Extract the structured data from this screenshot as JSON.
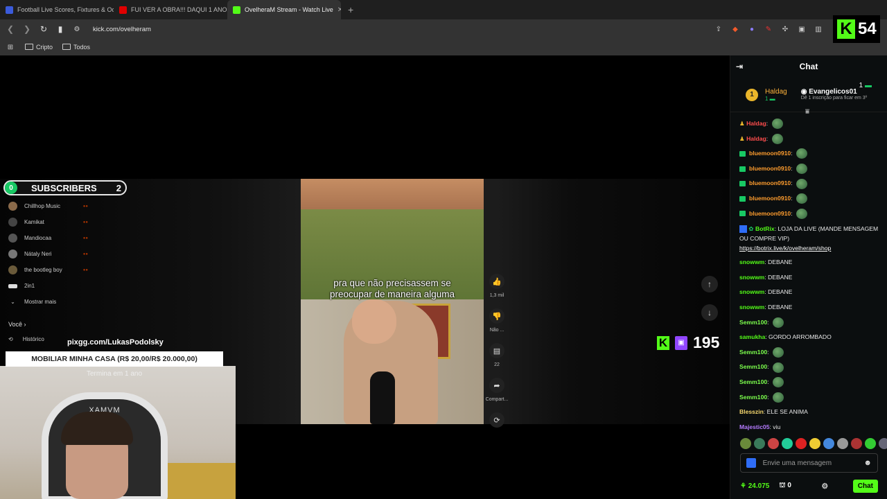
{
  "browser": {
    "tabs": [
      {
        "title": "Football Live Scores, Fixtures & Odds",
        "favicon_color": "#3b5bdb",
        "active": false
      },
      {
        "title": "FUI VER A OBRA!!! DAQUI 1 ANO VOU",
        "favicon_color": "#e00000",
        "active": false
      },
      {
        "title": "OvelheraM Stream - Watch Live",
        "favicon_color": "#53fc18",
        "active": true
      }
    ],
    "new_tab_glyph": "+",
    "close_glyph": "✕",
    "url": "kick.com/ovelheram",
    "bookmarks": [
      "Cripto",
      "Todos"
    ],
    "badge_count": "54"
  },
  "stream": {
    "subscribers_label": "SUBSCRIBERS",
    "subscribers_left": "0",
    "subscribers_right": "2",
    "youtube_sidebar": [
      "Chillhop Music",
      "Kamikat",
      "Mandiocaa",
      "Nátaly Neri",
      "the bootleg boy",
      "2in1",
      "Mostrar mais"
    ],
    "voce": "Você",
    "historico": "Histórico",
    "pix_link": "pixgg.com/LukasPodolsky",
    "goal_text": "MOBILIAR MINHA CASA (R$ 20,00/R$ 20.000,00)",
    "goal_sub": "Termina em 1 ano",
    "chair_brand": "XAMVM",
    "caption_line1": "pra que não precisassem se",
    "caption_line2": "preocupar de maneira alguma",
    "side_actions": [
      {
        "icon": "like-icon",
        "glyph": "👍",
        "label": "1,3 mil"
      },
      {
        "icon": "dislike-icon",
        "glyph": "👎",
        "label": "Não ..."
      },
      {
        "icon": "comment-icon",
        "glyph": "▤",
        "label": "22"
      },
      {
        "icon": "share-icon",
        "glyph": "➦",
        "label": "Compart..."
      },
      {
        "icon": "remix-icon",
        "glyph": "⟳",
        "label": ""
      }
    ],
    "viewer_count": "195"
  },
  "chat": {
    "title": "Chat",
    "pinned_left": {
      "name": "Haldag",
      "rank": "1",
      "subs": "1"
    },
    "pinned_right": {
      "name": "Evangelicos01",
      "hint": "Dê 1 inscrição para ficar em 3º",
      "subs": "1"
    },
    "messages": [
      {
        "user": "Haldag",
        "color": "#ff4d4d",
        "text": "",
        "emote": true
      },
      {
        "user": "Haldag",
        "color": "#ff4d4d",
        "text": "",
        "emote": true
      },
      {
        "user": "bluemoon0910",
        "color": "#ff9d2e",
        "text": "",
        "emote": true
      },
      {
        "user": "bluemoon0910",
        "color": "#ff9d2e",
        "text": "",
        "emote": true
      },
      {
        "user": "bluemoon0910",
        "color": "#ff9d2e",
        "text": "",
        "emote": true
      },
      {
        "user": "bluemoon0910",
        "color": "#ff9d2e",
        "text": "",
        "emote": true
      },
      {
        "user": "bluemoon0910",
        "color": "#ff9d2e",
        "text": "",
        "emote": true
      }
    ],
    "botrix": {
      "user": "BotRix",
      "text": "LOJA DA LIVE (MANDE MENSAGEM OU COMPRE VIP)",
      "link": "https://botrix.live/k/ovelheram/shop"
    },
    "messages2": [
      {
        "user": "snowwm",
        "color": "#53fc18",
        "text": "DEBANE",
        "emote": false
      },
      {
        "user": "snowwm",
        "color": "#53fc18",
        "text": "DEBANE",
        "emote": false
      },
      {
        "user": "snowwm",
        "color": "#53fc18",
        "text": "DEBANE",
        "emote": false
      },
      {
        "user": "snowwm",
        "color": "#53fc18",
        "text": "DEBANE",
        "emote": false
      },
      {
        "user": "Semm100",
        "color": "#7cff4d",
        "text": "",
        "emote": true
      },
      {
        "user": "samukha",
        "color": "#53fc18",
        "text": "GORDO ARROMBADO",
        "emote": false
      },
      {
        "user": "Semm100",
        "color": "#7cff4d",
        "text": "",
        "emote": true
      },
      {
        "user": "Semm100",
        "color": "#7cff4d",
        "text": "",
        "emote": true
      },
      {
        "user": "Semm100",
        "color": "#7cff4d",
        "text": "",
        "emote": true
      },
      {
        "user": "Semm100",
        "color": "#7cff4d",
        "text": "",
        "emote": true
      },
      {
        "user": "Blesszin",
        "color": "#f5d76e",
        "text": "ELE SE ANIMA",
        "emote": false
      },
      {
        "user": "Majestic05",
        "color": "#b57bff",
        "text": "viu",
        "emote": false
      }
    ],
    "input_placeholder": "Envie uma mensagem",
    "points": "24.075",
    "gift_count": "0",
    "chat_button": "Chat"
  }
}
